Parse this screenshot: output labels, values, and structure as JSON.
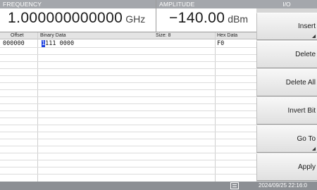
{
  "frequency": {
    "label": "FREQUENCY",
    "value": "1.000000000000",
    "unit": "GHz"
  },
  "amplitude": {
    "label": "AMPLITUDE",
    "value": "−140.00",
    "unit": "dBm"
  },
  "panel": {
    "title": "I/O",
    "softkeys": [
      {
        "label": "Insert"
      },
      {
        "label": "Delete"
      },
      {
        "label": "Delete All"
      },
      {
        "label": "Invert Bit"
      },
      {
        "label": "Go To"
      },
      {
        "label": "Apply"
      }
    ]
  },
  "table": {
    "headers": {
      "offset": "Offset",
      "binary": "Binary Data",
      "size": "Size: 8",
      "hex": "Hex Data"
    },
    "rows": [
      {
        "offset": "000000",
        "binary_cursor": "1",
        "binary_rest": "111 0000",
        "hex": "F0"
      }
    ]
  },
  "status": {
    "icon": "network-icon",
    "datetime": "2024/09/25 22:16:0"
  }
}
